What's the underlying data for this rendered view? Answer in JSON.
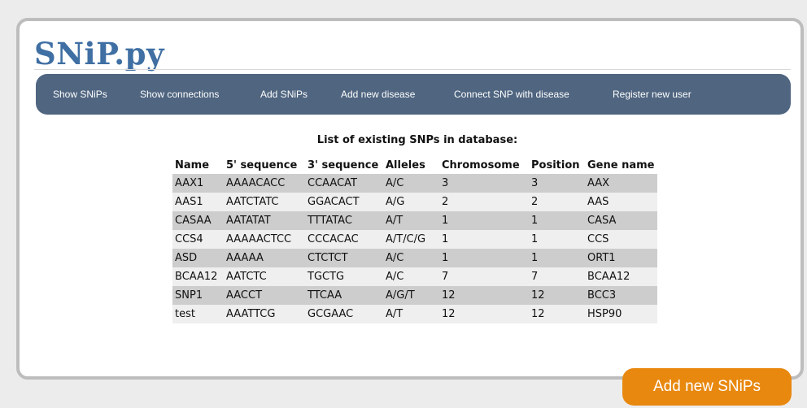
{
  "app": {
    "logo_text": "SNiP.py"
  },
  "nav": {
    "items": [
      {
        "label": "Show SNiPs"
      },
      {
        "label": "Show connections"
      },
      {
        "label": "Add SNiPs"
      },
      {
        "label": "Add new disease"
      },
      {
        "label": "Connect SNP with disease"
      },
      {
        "label": "Register new user"
      }
    ]
  },
  "main": {
    "caption": "List of existing SNPs in database:",
    "table": {
      "columns": [
        "Name",
        "5' sequence",
        "3' sequence",
        "Alleles",
        "Chromosome",
        "Position",
        "Gene name"
      ],
      "rows": [
        [
          "AAX1",
          "AAAACACC",
          "CCAACAT",
          "A/C",
          "3",
          "3",
          "AAX"
        ],
        [
          "AAS1",
          "AATCTATC",
          "GGACACT",
          "A/G",
          "2",
          "2",
          "AAS"
        ],
        [
          "CASAA",
          "AATATAT",
          "TTTATAC",
          "A/T",
          "1",
          "1",
          "CASA"
        ],
        [
          "CCS4",
          "AAAAACTCC",
          "CCCACAC",
          "A/T/C/G",
          "1",
          "1",
          "CCS"
        ],
        [
          "ASD",
          "AAAAA",
          "CTCTCT",
          "A/C",
          "1",
          "1",
          "ORT1"
        ],
        [
          "BCAA12",
          "AATCTC",
          "TGCTG",
          "A/C",
          "7",
          "7",
          "BCAA12"
        ],
        [
          "SNP1",
          "AACCT",
          "TTCAA",
          "A/G/T",
          "12",
          "12",
          "BCC3"
        ],
        [
          "test",
          "AAATTCG",
          "GCGAAC",
          "A/T",
          "12",
          "12",
          "HSP90"
        ]
      ]
    }
  },
  "actions": {
    "add_new_label": "Add new SNiPs"
  },
  "colors": {
    "logo": "#3f6fa3",
    "navbar": "#4f6580",
    "button": "#e8880f",
    "row_odd": "#cdcdcd",
    "row_even": "#efefef"
  }
}
